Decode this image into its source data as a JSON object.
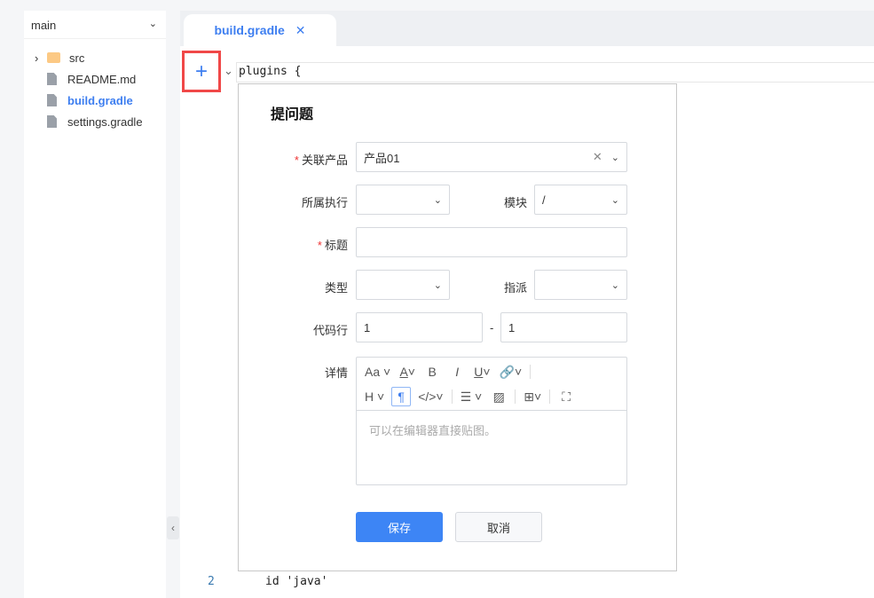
{
  "sidebar": {
    "branch": "main",
    "tree": [
      {
        "label": "src",
        "type": "folder"
      },
      {
        "label": "README.md"
      },
      {
        "label": "build.gradle",
        "active": true
      },
      {
        "label": "settings.gradle"
      }
    ]
  },
  "tab": {
    "label": "build.gradle",
    "close": "✕"
  },
  "code": {
    "line1": "plugins {",
    "line2_num": "2",
    "line2": "id 'java'",
    "add": "+"
  },
  "dialog": {
    "title": "提问题",
    "product_label": "关联产品",
    "product_value": "产品01",
    "execution_label": "所属执行",
    "module_label": "模块",
    "module_value": "/",
    "title_label": "标题",
    "type_label": "类型",
    "assign_label": "指派",
    "lines_label": "代码行",
    "line_from": "1",
    "line_sep": "-",
    "line_to": "1",
    "detail_label": "详情",
    "detail_placeholder": "可以在编辑器直接贴图。",
    "save": "保存",
    "cancel": "取消"
  }
}
